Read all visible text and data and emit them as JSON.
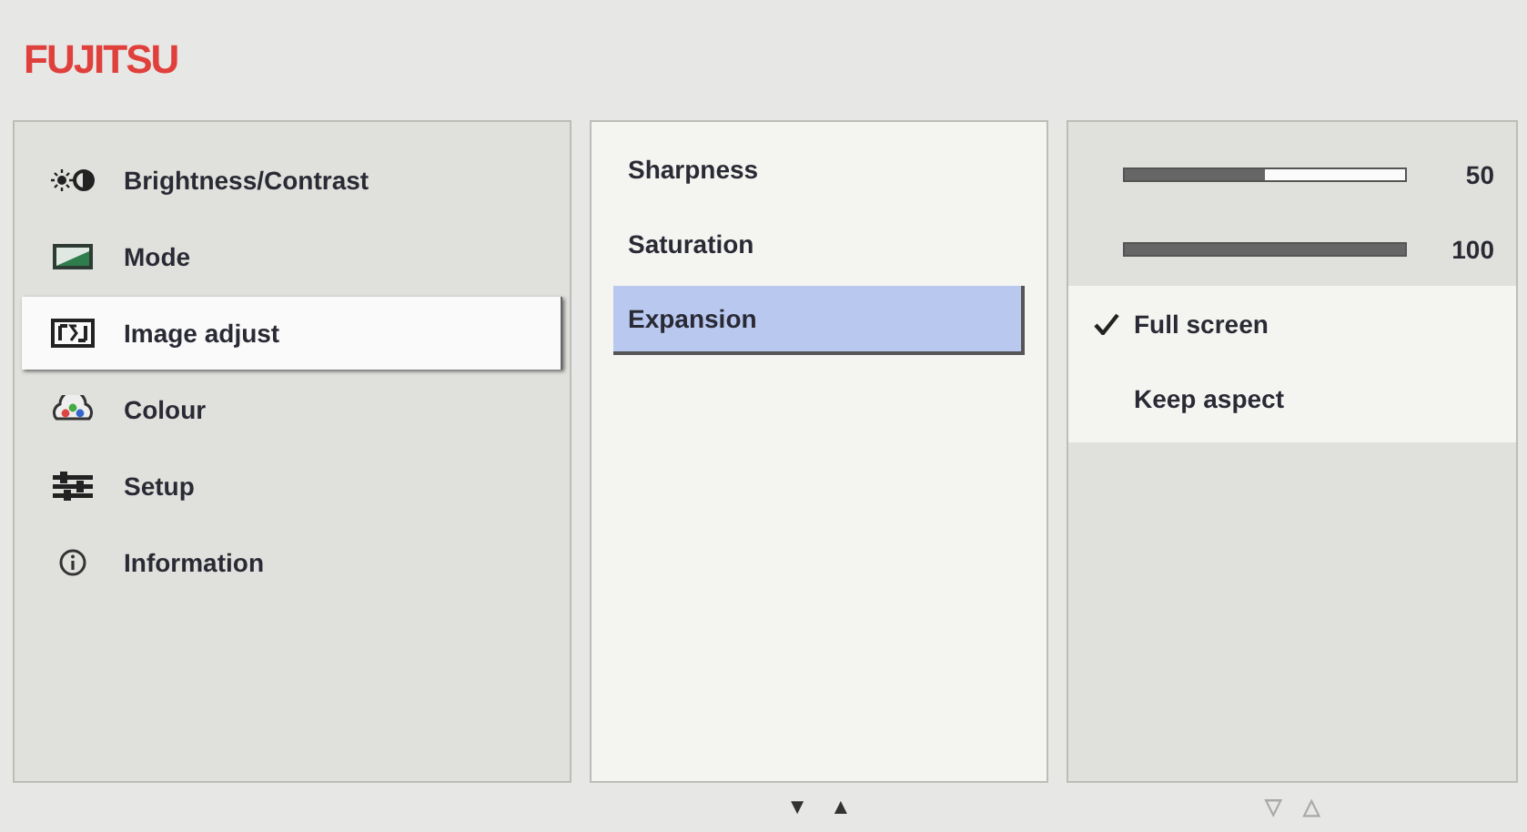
{
  "logo": "FUJITSU",
  "menu": [
    {
      "label": "Brightness/Contrast",
      "selected": false
    },
    {
      "label": "Mode",
      "selected": false
    },
    {
      "label": "Image adjust",
      "selected": true
    },
    {
      "label": "Colour",
      "selected": false
    },
    {
      "label": "Setup",
      "selected": false
    },
    {
      "label": "Information",
      "selected": false
    }
  ],
  "submenu": [
    {
      "label": "Sharpness",
      "selected": false
    },
    {
      "label": "Saturation",
      "selected": false
    },
    {
      "label": "Expansion",
      "selected": true
    }
  ],
  "sliders": [
    {
      "level": 0.5,
      "reading": "50"
    },
    {
      "level": 1.0,
      "reading": "100"
    }
  ],
  "options": [
    {
      "label": "Full screen",
      "checked": true
    },
    {
      "label": "Keep aspect",
      "checked": false
    }
  ],
  "nav": [
    {
      "arrows": [
        {
          "symbol": "▼",
          "disabled": false
        },
        {
          "symbol": "▲",
          "disabled": false
        }
      ]
    },
    {
      "arrows": [
        {
          "symbol": "▽",
          "disabled": true
        },
        {
          "symbol": "△",
          "disabled": true
        }
      ]
    }
  ]
}
